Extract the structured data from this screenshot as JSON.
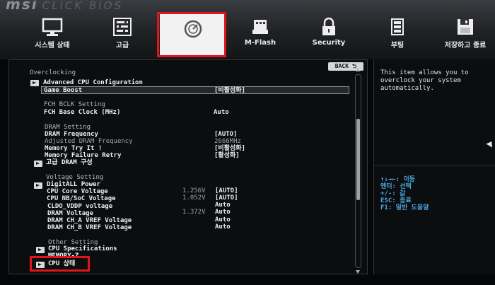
{
  "brand": {
    "logo": "msi",
    "subtitle": "CLICK BIOS"
  },
  "nav": {
    "items": [
      {
        "label": "시스템 상태",
        "icon": "monitor-icon"
      },
      {
        "label": "고급",
        "icon": "settings-panel-icon"
      },
      {
        "label": "",
        "icon": "gauge-icon"
      },
      {
        "label": "M-Flash",
        "icon": "usb-flash-icon"
      },
      {
        "label": "Security",
        "icon": "lock-icon"
      },
      {
        "label": "부팅",
        "icon": "boot-icon"
      },
      {
        "label": "저장하고 종료",
        "icon": "floppy-icon"
      }
    ]
  },
  "panel": {
    "back_label": "BACK ⮌",
    "title": "Overclocking",
    "advanced_cpu": "Advanced CPU Configuration",
    "game_boost": {
      "label": "Game Boost",
      "value": "[비활성화]"
    },
    "fch_section": "FCH BCLK Setting",
    "fch_base_clock": {
      "label": "FCH Base Clock (MHz)",
      "value": "Auto"
    },
    "dram_section": "DRAM Setting",
    "dram_frequency": {
      "label": "DRAM Frequency",
      "value": "[AUTO]"
    },
    "adjusted_dram": {
      "label": "Adjusted DRAM Frequency",
      "value": "2666MHz"
    },
    "memory_try_it": {
      "label": "Memory Try It !",
      "value": "[비활성화]"
    },
    "memory_failure_retry": {
      "label": "Memory Failure Retry",
      "value": "[활성화]"
    },
    "advanced_dram": "고급 DRAM 구성",
    "voltage_section": "Voltage Setting",
    "digitall_power": "DigitALL Power",
    "cpu_core_voltage": {
      "label": "CPU Core Voltage",
      "reading": "1.256V",
      "value": "[AUTO]"
    },
    "cpu_nb_soc_voltage": {
      "label": "CPU NB/SoC Voltage",
      "reading": "1.052V",
      "value": "[AUTO]"
    },
    "cldo_vddp_voltage": {
      "label": "CLDO_VDDP voltage",
      "value": "Auto"
    },
    "dram_voltage": {
      "label": "DRAM Voltage",
      "reading": "1.372V",
      "value": "Auto"
    },
    "dram_cha_vref": {
      "label": "DRAM CH_A VREF Voltage",
      "value": "Auto"
    },
    "dram_chb_vref": {
      "label": "DRAM CH_B VREF Voltage",
      "value": "Auto"
    },
    "other_section": "Other Setting",
    "cpu_specifications": "CPU Specifications",
    "memory_z": "MEMORY-Z",
    "cpu_status": "CPU 상태"
  },
  "help": {
    "description": "This item allows you to overclock your system automatically.",
    "keys": [
      "↑↓→←: 이동",
      "엔터: 선택",
      "+/-: 값",
      "ESC: 종료",
      "F1: 일반 도움말"
    ]
  },
  "colors": {
    "accent_red": "#e3141a",
    "key_blue": "#4aa8e0"
  }
}
